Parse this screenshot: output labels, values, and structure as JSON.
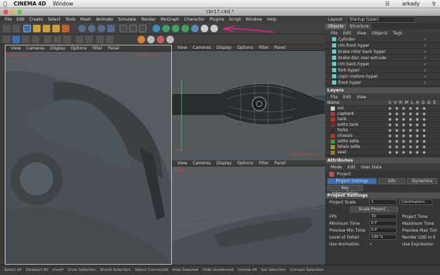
{
  "mac_menubar": {
    "app_name": "CINEMA 4D",
    "window_menu": "Window",
    "user": "arkady"
  },
  "window": {
    "title": "cbr17.c4d *"
  },
  "menubar": {
    "items": [
      "File",
      "Edit",
      "Create",
      "Select",
      "Tools",
      "Mesh",
      "Animate",
      "Simulate",
      "Render",
      "MoGraph",
      "Character",
      "Plugins",
      "Script",
      "Window",
      "Help"
    ]
  },
  "layout": {
    "label": "Layout:",
    "value": "Startup (User)"
  },
  "viewport_menu": [
    "View",
    "Cameras",
    "Display",
    "Options",
    "Filter",
    "Panel"
  ],
  "viewports": {
    "v1_label": "Perspective",
    "v1_right": "Safe Frame",
    "v2_right": "Top Wireframe",
    "v3_label": "Right"
  },
  "object_manager": {
    "tabs": [
      "Objects",
      "Structure"
    ],
    "menu": [
      "File",
      "Edit",
      "View",
      "Objects",
      "Tags"
    ],
    "items": [
      {
        "name": "Cylinder",
        "color": "#7ecfd0"
      },
      {
        "name": "rim front hyper",
        "color": "#7ecfd0"
      },
      {
        "name": "brake rotor back hyper",
        "color": "#7ecfd0"
      },
      {
        "name": "brake disc rear extrude",
        "color": "#7ecfd0"
      },
      {
        "name": "rim back hyper",
        "color": "#7ecfd0"
      },
      {
        "name": "fork hyper",
        "color": "#7ecfd0"
      },
      {
        "name": "copri motore hyper",
        "color": "#7ecfd0"
      },
      {
        "name": "front hyper",
        "color": "#7ecfd0"
      }
    ]
  },
  "layers": {
    "title": "Layers",
    "menu": [
      "File",
      "Edit",
      "View"
    ],
    "col_name": "Name",
    "col_flags": "S V R M L A G D E",
    "items": [
      {
        "name": "set",
        "color": "#d0d0d0"
      },
      {
        "name": "captank",
        "color": "#c03030"
      },
      {
        "name": "tank",
        "color": "#c03030"
      },
      {
        "name": "sotto tank",
        "color": "#7a3030"
      },
      {
        "name": "forks",
        "color": "#303030"
      },
      {
        "name": "chassis",
        "color": "#c03030"
      },
      {
        "name": "sotto sella",
        "color": "#30a030"
      },
      {
        "name": "telaio sella",
        "color": "#a0a030"
      },
      {
        "name": "seat",
        "color": "#a08030"
      }
    ]
  },
  "attributes": {
    "title": "Attributes",
    "menu": [
      "Mode",
      "Edit",
      "User Data"
    ],
    "object": "Project",
    "tabs": [
      "Project Settings",
      "Info",
      "Dynamics"
    ],
    "subtab": "Key Interpolation",
    "section": "Project Settings",
    "project_scale_label": "Project Scale",
    "project_scale_value": "1",
    "project_scale_unit": "Centimeters",
    "scale_button": "Scale Project...",
    "fps_label": "FPS",
    "fps_value": "30",
    "project_time_label": "Project Time",
    "min_time_label": "Minimum Time",
    "min_time_value": "0 F",
    "max_time_label": "Maximum Time",
    "preview_min_label": "Preview Min Time",
    "preview_min_value": "0 F",
    "preview_max_label": "Preview Max Tim",
    "lod_label": "Level of Detail",
    "lod_value": "100 %",
    "render_lod_label": "Render LOD in E",
    "use_anim_label": "Use Animation",
    "use_expr_label": "Use Expression"
  },
  "statusbar": {
    "items": [
      "Select All",
      "Deselect All",
      "Invert",
      "Grow Selection",
      "Shrink Selection",
      "Select Connected",
      "Hide Selected",
      "Hide Unselected",
      "Unhide All",
      "Set Selection",
      "Convert Selection"
    ]
  }
}
